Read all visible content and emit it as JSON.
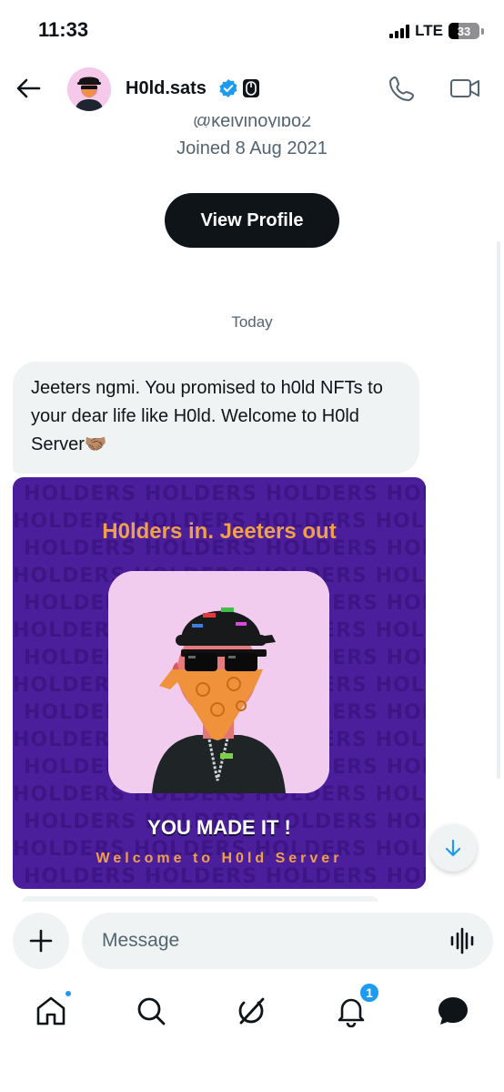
{
  "status_bar": {
    "time": "11:33",
    "network": "LTE",
    "battery": "33",
    "battery_level": 0.33
  },
  "header": {
    "name": "H0ld.sats"
  },
  "profile": {
    "handle": "@kelvinoyibo2",
    "joined": "Joined 8 Aug 2021",
    "view_profile_label": "View Profile"
  },
  "conversation": {
    "day_separator": "Today",
    "messages": [
      {
        "text": "Jeeters ngmi. You promised to h0ld NFTs to your dear life like H0ld. Welcome to H0ld Server🤝🏽"
      }
    ],
    "image_card": {
      "watermark": "HOLDERS",
      "headline": "H0lders in. Jeeters out",
      "made_it": "YOU MADE IT !",
      "welcome": "Welcome to H0ld Server"
    }
  },
  "composer": {
    "placeholder": "Message"
  },
  "nav": {
    "notifications_count": "1"
  },
  "colors": {
    "accent": "#1d9bf0",
    "card_purple": "#4b1f9c",
    "card_orange": "#f0a048",
    "bubble_gray": "#eff3f4"
  },
  "icons": [
    "back-arrow-icon",
    "verified-icon",
    "badge-icon",
    "phone-icon",
    "video-icon",
    "arrow-down-icon",
    "plus-icon",
    "voice-icon",
    "home-icon",
    "search-icon",
    "grok-icon",
    "bell-icon",
    "messages-icon"
  ]
}
